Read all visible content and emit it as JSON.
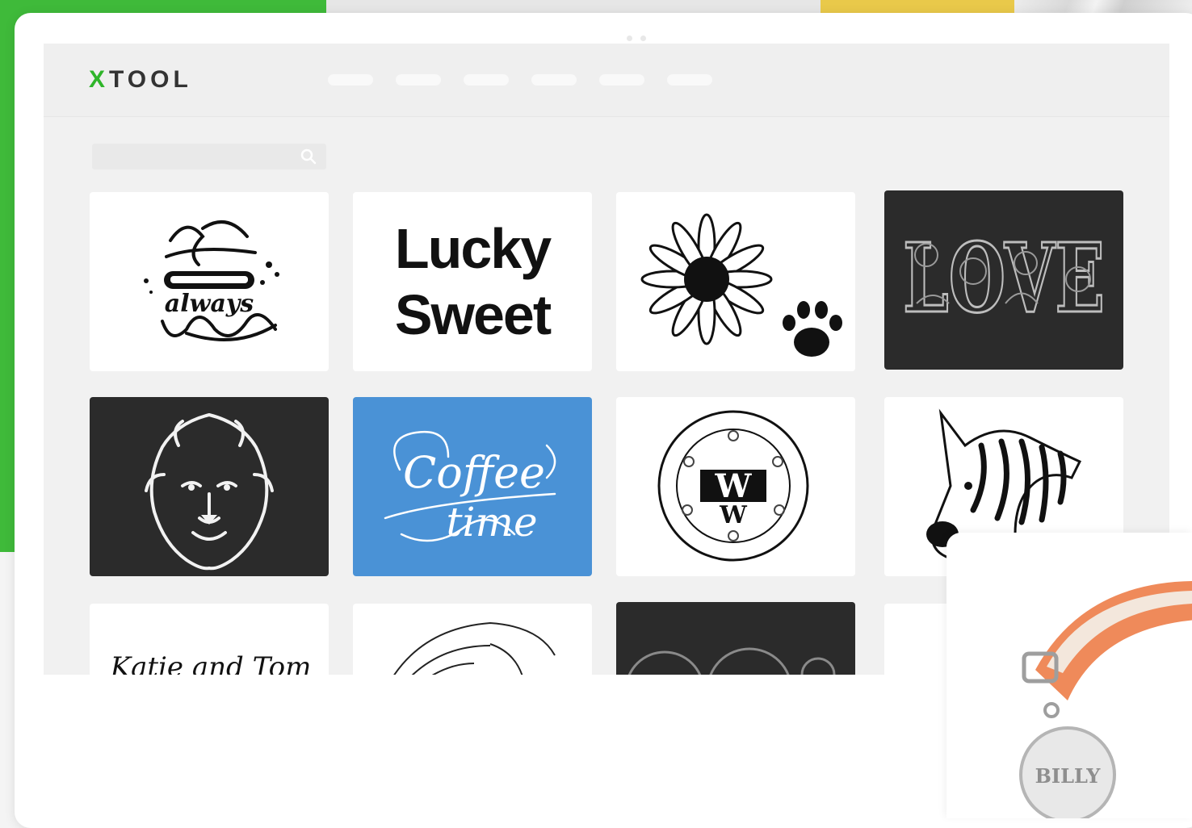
{
  "brand": {
    "logo_x": "X",
    "logo_rest": "TOOL",
    "accent": "#2fb52a"
  },
  "colors": {
    "background_green": "#3fba3a",
    "background_yellow": "#e9c94a",
    "tile_dark": "#2b2b2b",
    "tile_blue": "#4a92d6",
    "collar": "#ef8a5a"
  },
  "nav_items": 6,
  "search": {
    "placeholder": ""
  },
  "gallery": {
    "row1": [
      {
        "name": "the-secret-always-love-design",
        "style": "light"
      },
      {
        "name": "lucky-sweet-design",
        "style": "light",
        "lines": [
          "Lucky",
          "Sweet"
        ]
      },
      {
        "name": "sunflower-paw-design",
        "style": "light"
      },
      {
        "name": "love-floral-design",
        "style": "dark",
        "text": "LOVE"
      }
    ],
    "row2": [
      {
        "name": "lion-head-design",
        "style": "dark"
      },
      {
        "name": "coffee-time-design",
        "style": "blue",
        "lines": [
          "Coffee",
          "time"
        ]
      },
      {
        "name": "monogram-w-wreath-design",
        "style": "light",
        "text": "W"
      },
      {
        "name": "zebra-design",
        "style": "light"
      }
    ],
    "row3_partial": [
      {
        "name": "katie-and-tom-design",
        "style": "light",
        "text": "Katie and Tom"
      },
      {
        "name": "eagle-sketch-design",
        "style": "light"
      },
      {
        "name": "ornament-design",
        "style": "dark"
      },
      {
        "name": "blank-design",
        "style": "light"
      }
    ]
  },
  "product": {
    "name": "engraved-pet-collar-tag",
    "tag_text": "BILLY"
  }
}
